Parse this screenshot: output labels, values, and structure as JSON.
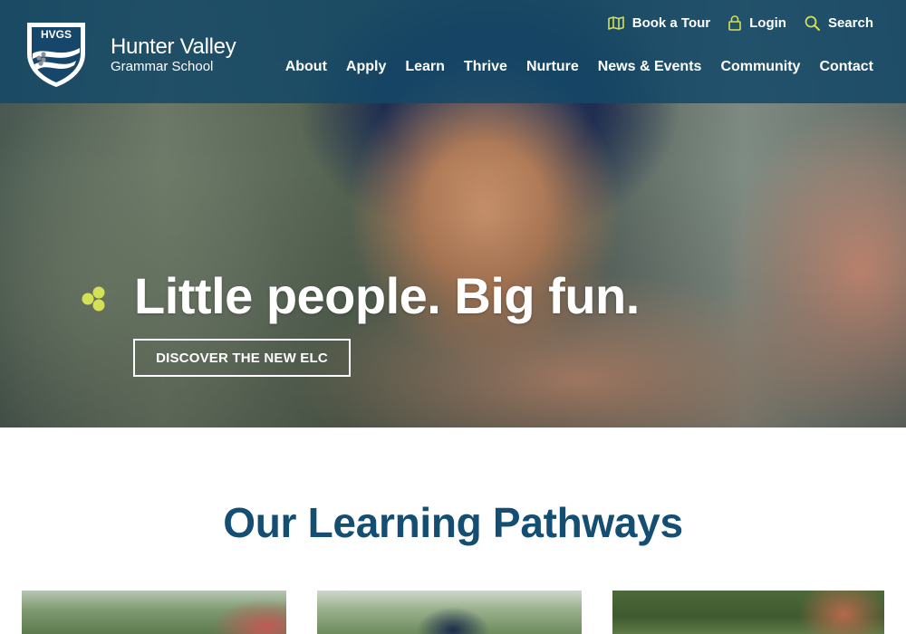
{
  "colors": {
    "brand_navy": "#144e72",
    "header_overlay": "#144868",
    "accent_lime": "#d4e157",
    "white": "#ffffff"
  },
  "brand": {
    "crest_text": "HVGS",
    "name_line1": "Hunter Valley",
    "name_line2": "Grammar School"
  },
  "utility_nav": [
    {
      "label": "Book a Tour",
      "icon": "map-icon"
    },
    {
      "label": "Login",
      "icon": "lock-icon"
    },
    {
      "label": "Search",
      "icon": "search-icon"
    }
  ],
  "main_nav": [
    "About",
    "Apply",
    "Learn",
    "Thrive",
    "Nurture",
    "News & Events",
    "Community",
    "Contact"
  ],
  "hero": {
    "title": "Little people. Big fun.",
    "cta_label": "DISCOVER THE NEW ELC",
    "image_subject": "smiling young child in navy bucket hat"
  },
  "section": {
    "title": "Our Learning Pathways"
  },
  "cards": [
    {
      "image_subject": "garden with flowers"
    },
    {
      "image_subject": "child in navy hat outdoors"
    },
    {
      "image_subject": "hedge with students"
    }
  ]
}
